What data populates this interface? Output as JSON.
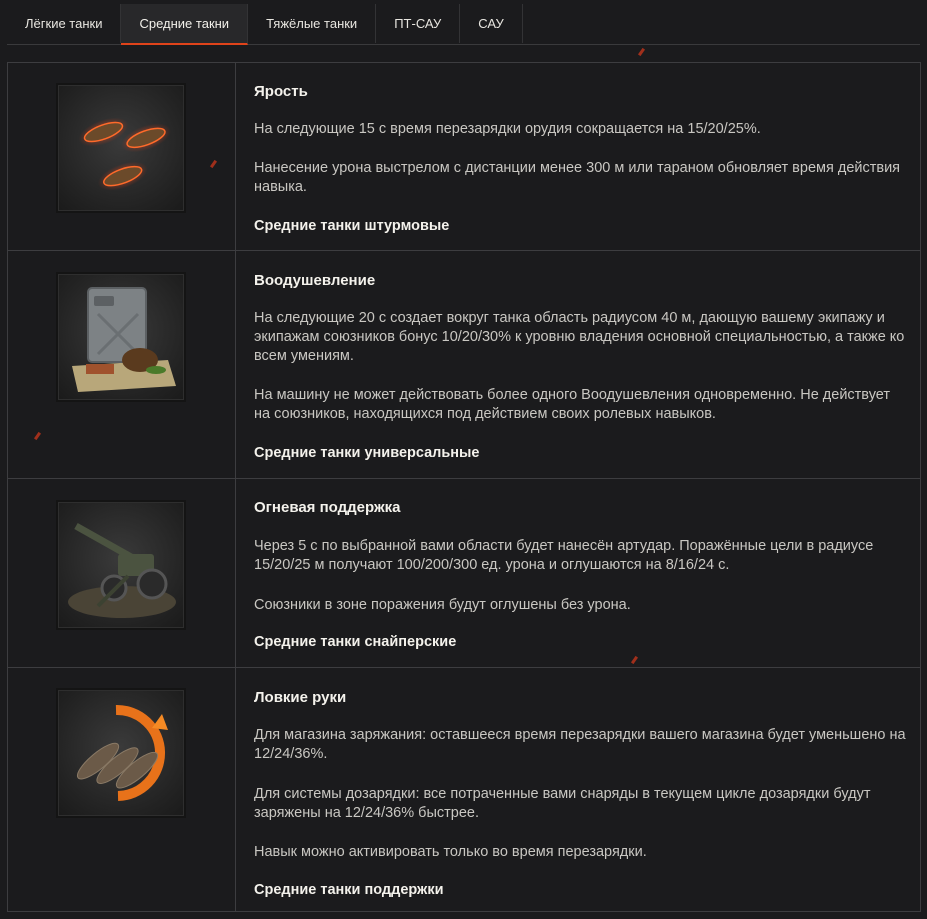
{
  "tabs": [
    {
      "label": "Лёгкие танки"
    },
    {
      "label": "Средние такни"
    },
    {
      "label": "Тяжёлые танки"
    },
    {
      "label": "ПТ-САУ"
    },
    {
      "label": "САУ"
    }
  ],
  "active_tab": "Средние такни",
  "skills": [
    {
      "icon": "bullets-icon",
      "title": "Ярость",
      "paragraphs": [
        "На следующие 15 с время перезарядки орудия сокращается на 15/20/25%.",
        "Нанесение урона выстрелом с дистанции менее 300 м или тараном обновляет время действия навыка."
      ],
      "category": "Средние танки штурмовые"
    },
    {
      "icon": "jerrycan-bread-icon",
      "title": "Воодушевление",
      "paragraphs": [
        "На следующие 20 с создает вокруг танка область радиусом 40 м, дающую вашему экипажу и экипажам союзников бонус 10/20/30% к уровню владения основной специальностью, а также ко всем умениям.",
        "На машину не может действовать более одного Воодушевления одновременно. Не действует на союзников, находящихся под действием своих ролевых навыков."
      ],
      "category": "Средние танки универсальные"
    },
    {
      "icon": "howitzer-icon",
      "title": "Огневая поддержка",
      "paragraphs": [
        "Через 5 с по выбранной вами области будет нанесён артудар. Поражённые цели в радиусе 15/20/25 м получают 100/200/300 ед. урона и оглушаются на 8/16/24 с.",
        "Союзники в зоне поражения будут оглушены без урона."
      ],
      "category": "Средние танки снайперские"
    },
    {
      "icon": "reload-shells-icon",
      "title": "Ловкие руки",
      "paragraphs": [
        "Для магазина заряжания: оставшееся время перезарядки вашего магазина будет уменьшено на 12/24/36%.",
        "Для системы дозарядки: все потраченные вами снаряды в текущем цикле дозарядки будут заряжены на 12/24/36% быстрее.",
        "Навык можно активировать только во время перезарядки."
      ],
      "category": "Средние танки поддержки"
    }
  ],
  "colors": {
    "accent": "#e0431a",
    "background": "#1b1b1d"
  }
}
